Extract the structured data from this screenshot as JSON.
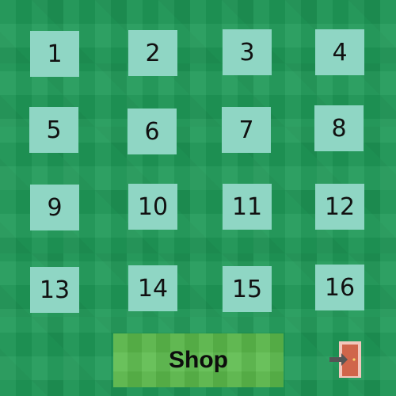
{
  "levels": [
    {
      "label": "1"
    },
    {
      "label": "2"
    },
    {
      "label": "3"
    },
    {
      "label": "4"
    },
    {
      "label": "5"
    },
    {
      "label": "6"
    },
    {
      "label": "7"
    },
    {
      "label": "8"
    },
    {
      "label": "9"
    },
    {
      "label": "10"
    },
    {
      "label": "11"
    },
    {
      "label": "12"
    },
    {
      "label": "13"
    },
    {
      "label": "14"
    },
    {
      "label": "15"
    },
    {
      "label": "16"
    }
  ],
  "shop": {
    "label": "Shop"
  },
  "exit": {
    "icon": "exit-door-icon"
  },
  "colors": {
    "background": "#1f9a58",
    "tile": "#8fd6c4",
    "shop_button": "#5cbb4c",
    "door": "#d0654a",
    "door_frame": "#f2c7bc",
    "arrow": "#555555"
  }
}
